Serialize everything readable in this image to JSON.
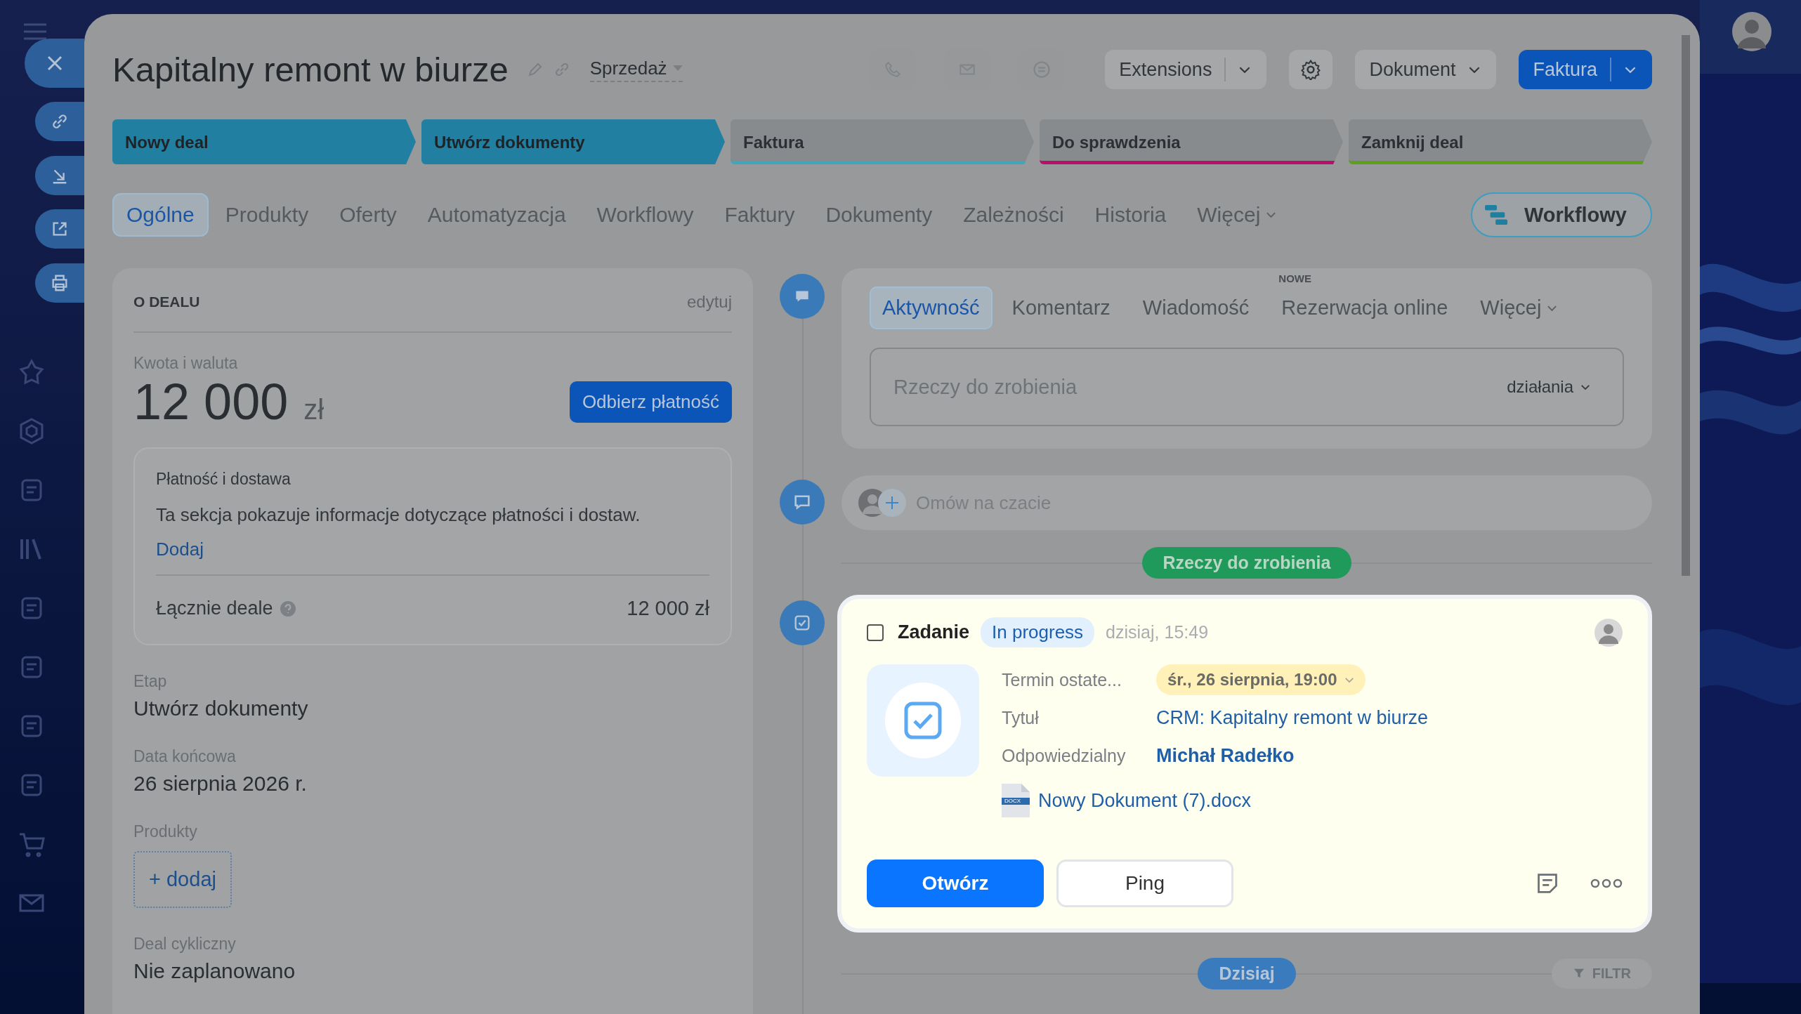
{
  "header": {
    "title": "Kapitalny remont w biurze",
    "pipeline": "Sprzedaż",
    "buttons": [
      {
        "label": "Extensions",
        "kind": "split"
      },
      {
        "label": "Dokument",
        "kind": "dropdown"
      },
      {
        "label": "Faktura",
        "kind": "primary"
      }
    ]
  },
  "stages": [
    {
      "label": "Nowy deal",
      "color": "#2180a2",
      "reached": true
    },
    {
      "label": "Utwórz dokumenty",
      "color": "#2180a2",
      "reached": true
    },
    {
      "label": "Faktura",
      "color": "#3fa6bb",
      "reached": false
    },
    {
      "label": "Do sprawdzenia",
      "color": "#b5106a",
      "reached": false
    },
    {
      "label": "Zamknij deal",
      "color": "#5f9f1c",
      "reached": false
    }
  ],
  "tabs": [
    {
      "label": "Ogólne",
      "selected": true,
      "kind": "tab"
    },
    {
      "label": "Produkty",
      "selected": false,
      "kind": "tab"
    },
    {
      "label": "Oferty",
      "selected": false,
      "kind": "tab"
    },
    {
      "label": "Automatyzacja",
      "selected": false,
      "kind": "tab"
    },
    {
      "label": "Workflowy",
      "selected": false,
      "kind": "tab"
    },
    {
      "label": "Faktury",
      "selected": false,
      "kind": "tab"
    },
    {
      "label": "Dokumenty",
      "selected": false,
      "kind": "tab"
    },
    {
      "label": "Zależności",
      "selected": false,
      "kind": "tab"
    },
    {
      "label": "Historia",
      "selected": false,
      "kind": "tab"
    },
    {
      "label": "Więcej",
      "selected": false,
      "kind": "dropdown"
    }
  ],
  "workflow_button": "Workflowy",
  "deal": {
    "heading": "O DEALU",
    "edit": "edytuj",
    "amount_label": "Kwota i waluta",
    "amount": "12 000",
    "currency": "zł",
    "pay_button": "Odbierz płatność",
    "payment": {
      "title": "Płatność i dostawa",
      "text": "Ta sekcja pokazuje informacje dotyczące płatności i dostaw.",
      "link": "Dodaj",
      "total_label": "Łącznie deale",
      "total": "12 000 zł"
    },
    "fields": [
      {
        "label": "Etap",
        "value": "Utwórz dokumenty",
        "kind": "text"
      },
      {
        "label": "Data końcowa",
        "value": "26 sierpnia 2026 r.",
        "kind": "text"
      },
      {
        "label": "Produkty",
        "value": "+ dodaj",
        "kind": "add"
      },
      {
        "label": "Deal cykliczny",
        "value": "Nie zaplanowano",
        "kind": "text"
      }
    ]
  },
  "composer": {
    "tabs": [
      {
        "label": "Aktywność",
        "selected": true,
        "kind": "tab"
      },
      {
        "label": "Komentarz",
        "selected": false,
        "kind": "tab"
      },
      {
        "label": "Wiadomość",
        "selected": false,
        "kind": "tab"
      },
      {
        "label": "Rezerwacja online",
        "selected": false,
        "kind": "tab",
        "badge": "NOWE"
      },
      {
        "label": "Więcej",
        "selected": false,
        "kind": "dropdown"
      }
    ],
    "placeholder": "Rzeczy do zrobienia",
    "actions": "działania"
  },
  "chat": {
    "placeholder": "Omów na czacie"
  },
  "todo_label": "Rzeczy do zrobienia",
  "task": {
    "checked": false,
    "title": "Zadanie",
    "status": "In progress",
    "time": "dzisiaj, 15:49",
    "fields": [
      {
        "label": "Termin ostate...",
        "value": "śr., 26 sierpnia, 19:00",
        "kind": "deadline"
      },
      {
        "label": "Tytuł",
        "value": "CRM: Kapitalny remont w biurze",
        "kind": "link"
      },
      {
        "label": "Odpowiedzialny",
        "value": "Michał Radełko",
        "kind": "person"
      }
    ],
    "file": {
      "name": "Nowy Dokument (7).docx",
      "ext": "DOCX"
    },
    "buttons": [
      {
        "label": "Otwórz",
        "kind": "primary"
      },
      {
        "label": "Ping",
        "kind": "secondary"
      }
    ]
  },
  "today_label": "Dzisiaj",
  "filter": "FILTR"
}
